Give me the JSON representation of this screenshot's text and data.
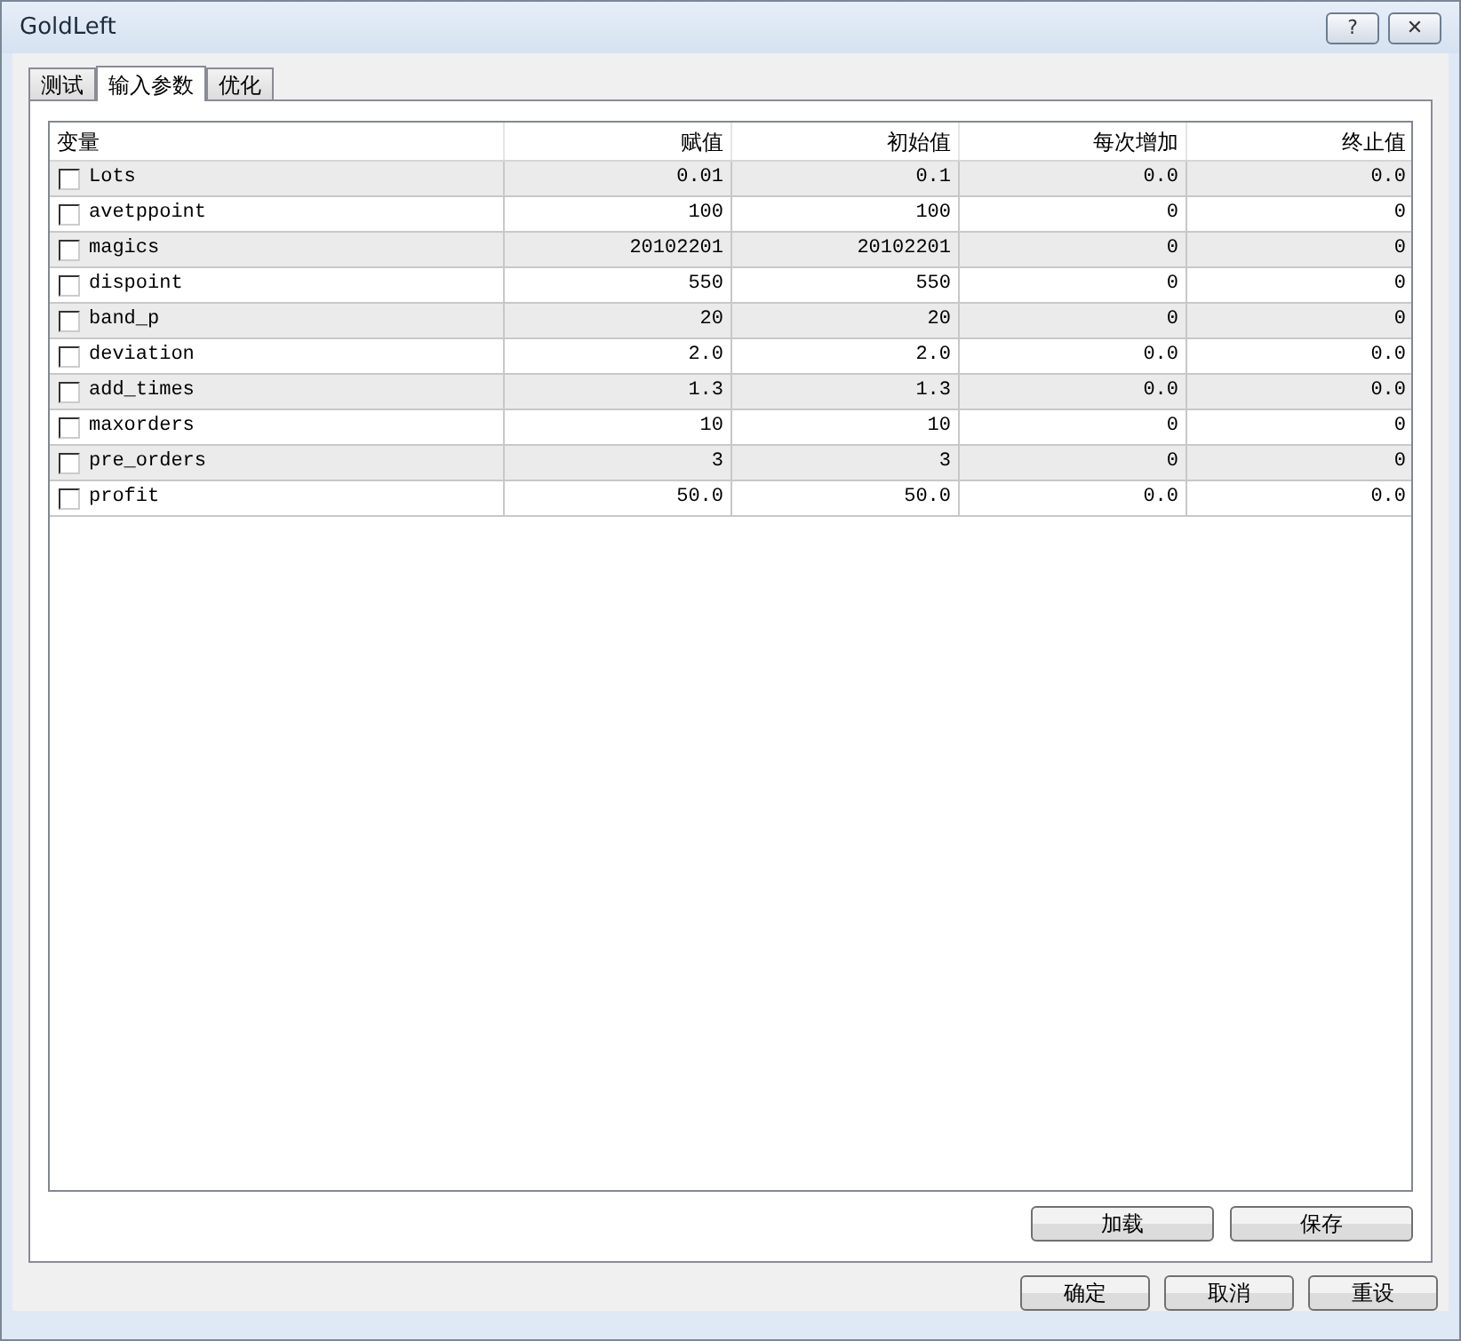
{
  "window": {
    "title": "GoldLeft",
    "controls": [
      "?",
      "✕"
    ]
  },
  "tabs": [
    {
      "label": "测试",
      "selected": false
    },
    {
      "label": "输入参数",
      "selected": true
    },
    {
      "label": "优化",
      "selected": false
    }
  ],
  "table": {
    "columns": [
      "变量",
      "赋值",
      "初始值",
      "每次增加",
      "终止值"
    ],
    "rows": [
      {
        "checked": false,
        "name": "Lots",
        "value": "0.01",
        "start": "0.1",
        "step": "0.0",
        "stop": "0.0"
      },
      {
        "checked": false,
        "name": "avetppoint",
        "value": "100",
        "start": "100",
        "step": "0",
        "stop": "0"
      },
      {
        "checked": false,
        "name": "magics",
        "value": "20102201",
        "start": "20102201",
        "step": "0",
        "stop": "0"
      },
      {
        "checked": false,
        "name": "dispoint",
        "value": "550",
        "start": "550",
        "step": "0",
        "stop": "0"
      },
      {
        "checked": false,
        "name": "band_p",
        "value": "20",
        "start": "20",
        "step": "0",
        "stop": "0"
      },
      {
        "checked": false,
        "name": "deviation",
        "value": "2.0",
        "start": "2.0",
        "step": "0.0",
        "stop": "0.0"
      },
      {
        "checked": false,
        "name": "add_times",
        "value": "1.3",
        "start": "1.3",
        "step": "0.0",
        "stop": "0.0"
      },
      {
        "checked": false,
        "name": "maxorders",
        "value": "10",
        "start": "10",
        "step": "0",
        "stop": "0"
      },
      {
        "checked": false,
        "name": "pre_orders",
        "value": "3",
        "start": "3",
        "step": "0",
        "stop": "0"
      },
      {
        "checked": false,
        "name": "profit",
        "value": "50.0",
        "start": "50.0",
        "step": "0.0",
        "stop": "0.0"
      }
    ]
  },
  "panel_buttons": [
    "加载",
    "保存"
  ],
  "dialog_buttons": [
    "确定",
    "取消",
    "重设"
  ]
}
